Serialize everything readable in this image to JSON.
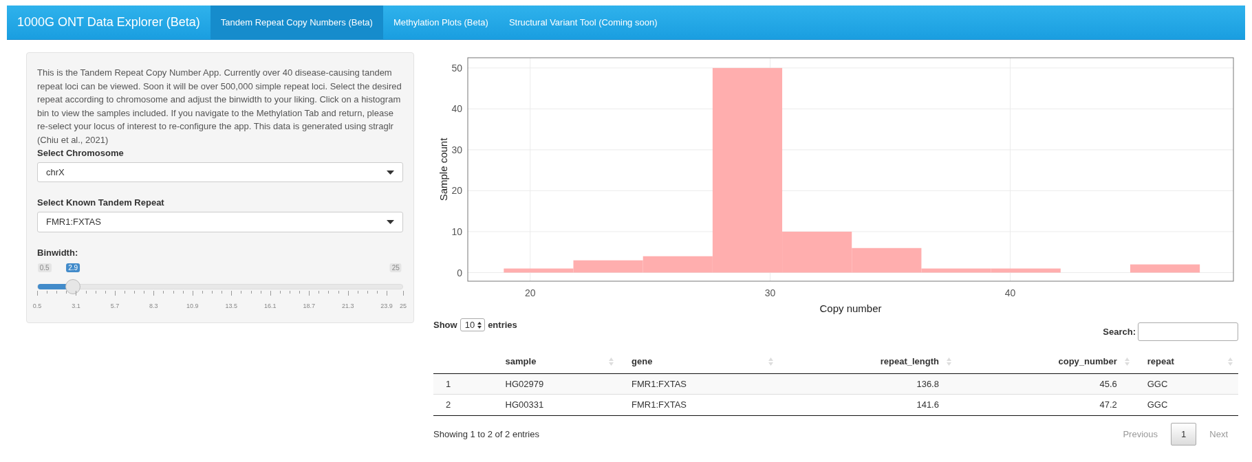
{
  "navbar": {
    "brand": "1000G ONT Data Explorer (Beta)",
    "tabs": [
      {
        "label": "Tandem Repeat Copy Numbers (Beta)",
        "selected": true
      },
      {
        "label": "Methylation Plots (Beta)",
        "selected": false
      },
      {
        "label": "Structural Variant Tool (Coming soon)",
        "selected": false
      }
    ]
  },
  "sidebar": {
    "description": "This is the Tandem Repeat Copy Number App. Currently over 40 disease-causing tandem repeat loci can be viewed. Soon it will be over 500,000 simple repeat loci. Select the desired repeat according to chromosome and adjust the binwidth to your liking. Click on a histogram bin to view the samples included. If you navigate to the Methylation Tab and return, please re-select your locus of interest to re-configure the app. This data is generated using straglr (Chiu et al., 2021)",
    "selects": [
      {
        "label": "Select Chromosome",
        "value": "chrX"
      },
      {
        "label": "Select Known Tandem Repeat",
        "value": "FMR1:FXTAS"
      }
    ],
    "slider": {
      "label": "Binwidth:",
      "min": "0.5",
      "max": "25",
      "value": "2.9",
      "level": 0.098,
      "ticks": [
        "0.5",
        "3.1",
        "5.7",
        "8.3",
        "10.9",
        "13.5",
        "16.1",
        "18.7",
        "21.3",
        "23.9",
        "25"
      ]
    }
  },
  "histogram": {
    "chart_data": {
      "type": "bar",
      "xlabel": "Copy number",
      "ylabel": "Sample count",
      "x": [
        20.35,
        23.25,
        26.15,
        29.05,
        31.95,
        34.85,
        37.75,
        40.65,
        43.55,
        46.45
      ],
      "series": [
        {
          "color": "#ffaeae",
          "values": [
            1,
            3,
            4,
            50,
            10,
            6,
            1,
            1,
            0,
            2
          ]
        }
      ],
      "grid": true,
      "xlim": [
        17.4,
        49.3
      ],
      "ylim": [
        -2.1,
        52.5
      ],
      "xticks": [
        20,
        30,
        40
      ],
      "yticks": [
        0,
        10,
        20,
        30,
        40,
        50
      ]
    }
  },
  "table": {
    "length_label_before": "Show",
    "length_value": "10",
    "length_label_after": "entries",
    "search_label": "Search:",
    "columns": [
      {
        "numeric": false
      },
      {
        "label": "sample",
        "numeric": false
      },
      {
        "label": "gene",
        "numeric": false
      },
      {
        "label": "repeat_length",
        "numeric": true
      },
      {
        "label": "copy_number",
        "numeric": true
      },
      {
        "label": "repeat",
        "numeric": false
      }
    ],
    "rows": [
      [
        "1",
        "HG02979",
        "FMR1:FXTAS",
        "136.8",
        "45.6",
        "GGC"
      ],
      [
        "2",
        "HG00331",
        "FMR1:FXTAS",
        "141.6",
        "47.2",
        "GGC"
      ]
    ],
    "info": "Showing 1 to 2 of 2 entries",
    "pagination": [
      {
        "label": "Previous",
        "selected": false,
        "disabled": true
      },
      {
        "label": "1",
        "selected": true,
        "disabled": false
      },
      {
        "label": "Next",
        "selected": false,
        "disabled": true
      }
    ]
  }
}
